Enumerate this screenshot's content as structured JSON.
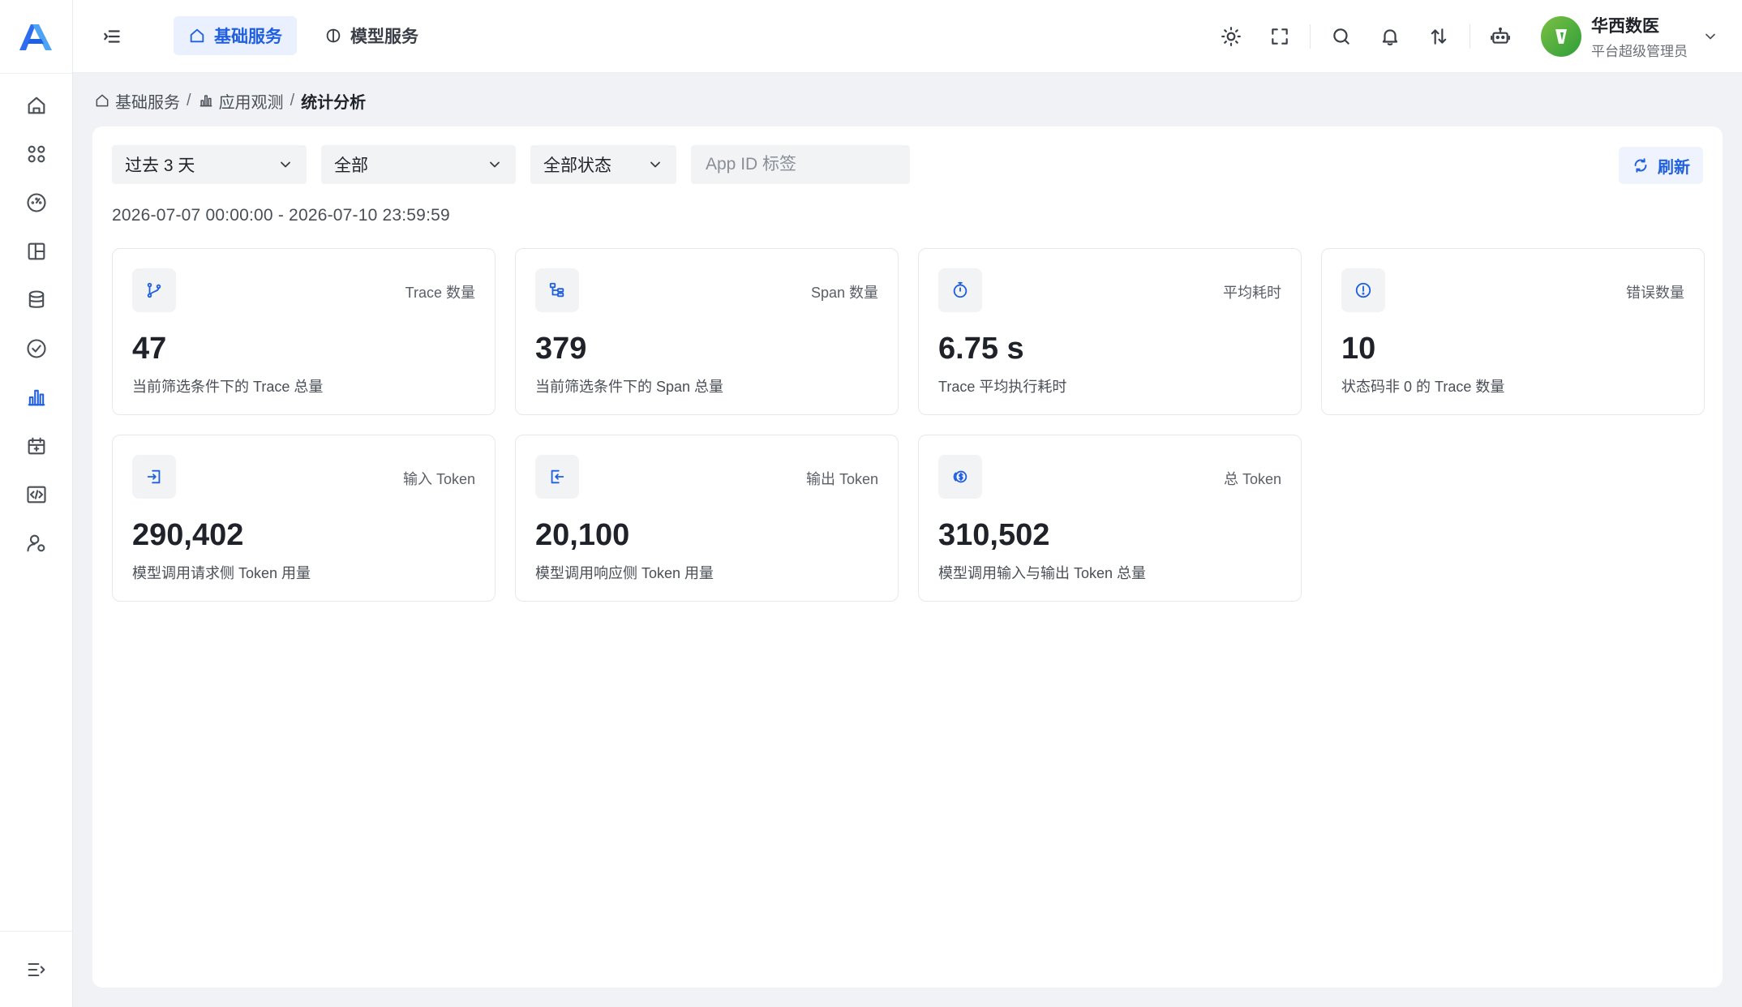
{
  "header": {
    "tabs": [
      {
        "label": "基础服务",
        "icon": "home-icon"
      },
      {
        "label": "模型服务",
        "icon": "brain-icon"
      }
    ],
    "user": {
      "name": "华西数医",
      "role": "平台超级管理员"
    }
  },
  "breadcrumb": {
    "items": [
      {
        "label": "基础服务",
        "icon": "home-icon"
      },
      {
        "label": "应用观测",
        "icon": "bar-chart-icon"
      }
    ],
    "separator": "/",
    "current": "统计分析"
  },
  "filters": {
    "time_range": "过去 3 天",
    "scope": "全部",
    "status": "全部状态",
    "app_id_placeholder": "App ID 标签",
    "refresh_label": "刷新"
  },
  "date_range": "2026-07-07 00:00:00 - 2026-07-10 23:59:59",
  "cards": [
    {
      "label": "Trace 数量",
      "value": "47",
      "desc": "当前筛选条件下的 Trace 总量",
      "icon": "branch-icon"
    },
    {
      "label": "Span 数量",
      "value": "379",
      "desc": "当前筛选条件下的 Span 总量",
      "icon": "tree-icon"
    },
    {
      "label": "平均耗时",
      "value": "6.75 s",
      "desc": "Trace 平均执行耗时",
      "icon": "timer-icon"
    },
    {
      "label": "错误数量",
      "value": "10",
      "desc": "状态码非 0 的 Trace 数量",
      "icon": "alert-circle-icon"
    },
    {
      "label": "输入 Token",
      "value": "290,402",
      "desc": "模型调用请求侧 Token 用量",
      "icon": "input-icon"
    },
    {
      "label": "输出 Token",
      "value": "20,100",
      "desc": "模型调用响应侧 Token 用量",
      "icon": "output-icon"
    },
    {
      "label": "总 Token",
      "value": "310,502",
      "desc": "模型调用输入与输出 Token 总量",
      "icon": "coins-icon"
    }
  ],
  "colors": {
    "accent": "#1f5fe0",
    "page_bg": "#f0f2f5"
  }
}
